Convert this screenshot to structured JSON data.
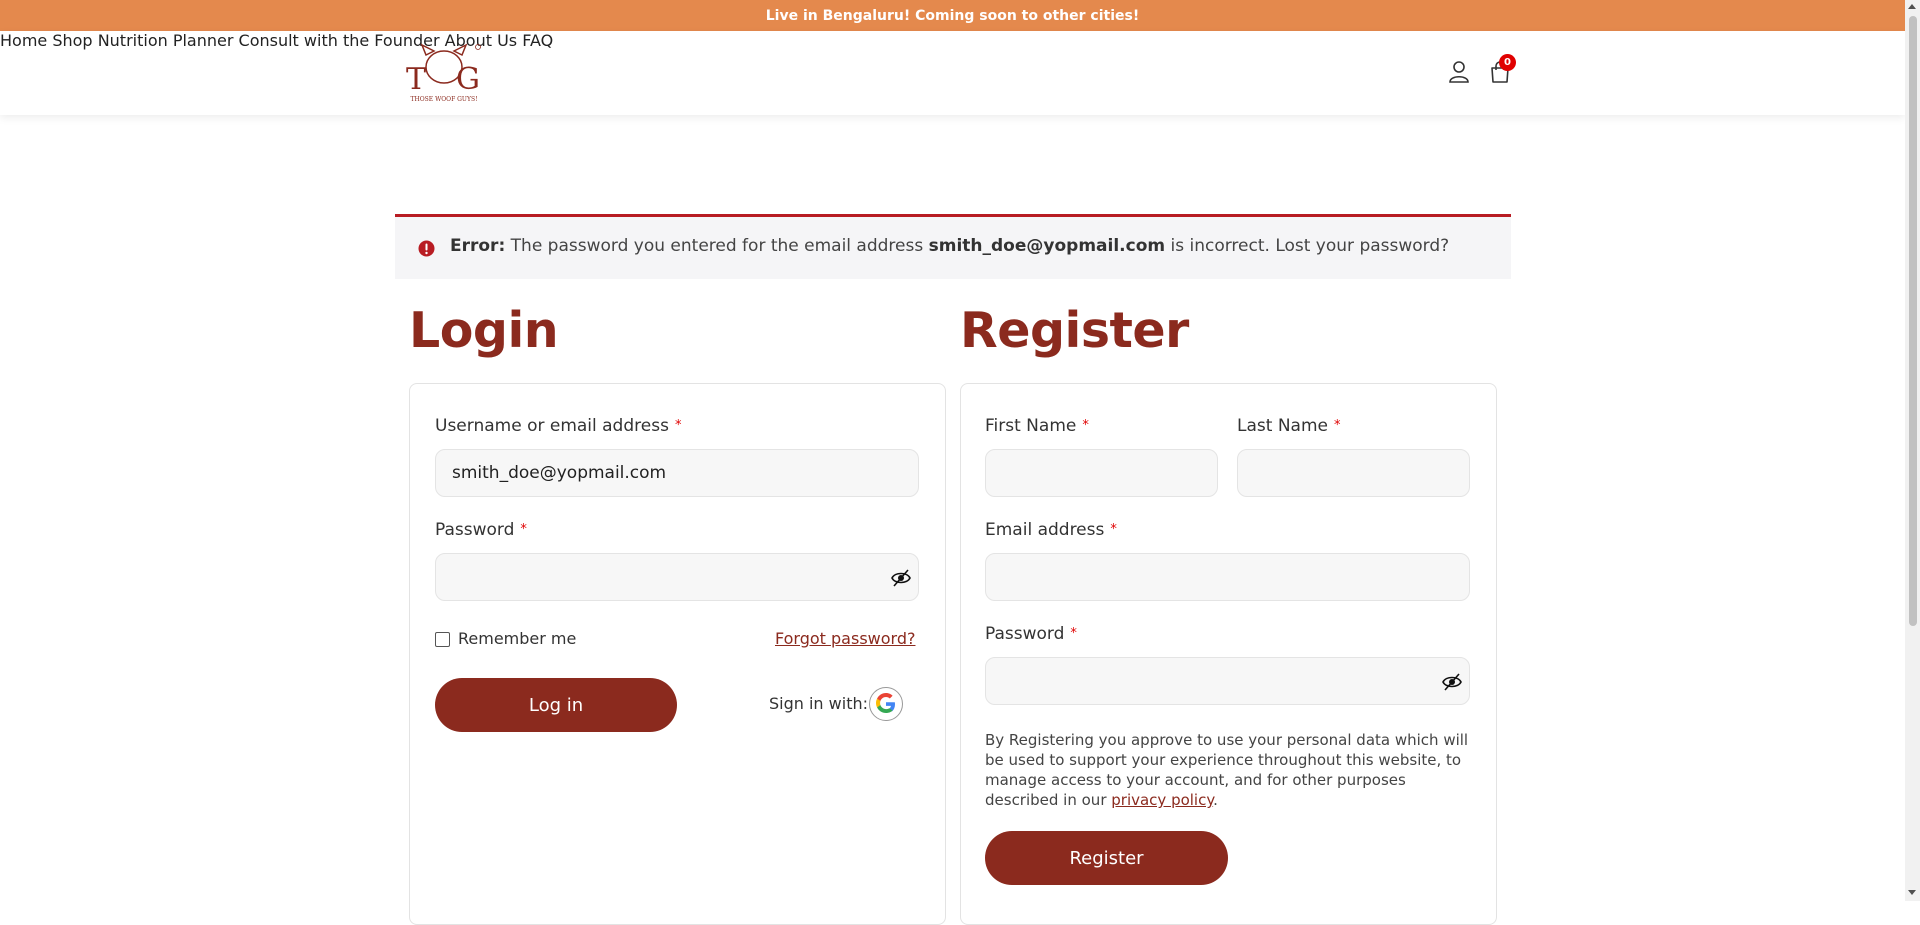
{
  "announcement": "Live in Bengaluru! Coming soon to other cities!",
  "logo": {
    "letters_left": "T",
    "letters_right": "G",
    "tagline": "THOSE WOOF GUYS!"
  },
  "nav": {
    "items": [
      "Home",
      "Shop",
      "Nutrition Planner",
      "Consult with the Founder",
      "About Us",
      "FAQ"
    ]
  },
  "cart": {
    "count": "0"
  },
  "error": {
    "prefix": "Error:",
    "text_before": " The password you entered for the email address ",
    "email": "smith_doe@yopmail.com",
    "text_after": " is incorrect. ",
    "lost_link": "Lost your password?"
  },
  "login": {
    "title": "Login",
    "username_label": "Username or email address",
    "username_value": "smith_doe@yopmail.com",
    "password_label": "Password",
    "password_value": "",
    "remember_label": "Remember me",
    "forgot_link": "Forgot password?",
    "login_button": "Log in",
    "signin_with": "Sign in with:"
  },
  "register": {
    "title": "Register",
    "first_name_label": "First Name",
    "last_name_label": "Last Name",
    "email_label": "Email address",
    "password_label": "Password",
    "consent_text": "By Registering you approve to use your personal data which will be used to support your experience throughout this website, to manage access to your account, and for other purposes described in our ",
    "privacy_link": "privacy policy",
    "consent_end": ".",
    "register_button": "Register"
  },
  "required_mark": "*",
  "colors": {
    "announcement_bg": "#e4894d",
    "brand": "#8b2a1e",
    "error_border": "#b81c23",
    "badge": "#e00000"
  }
}
